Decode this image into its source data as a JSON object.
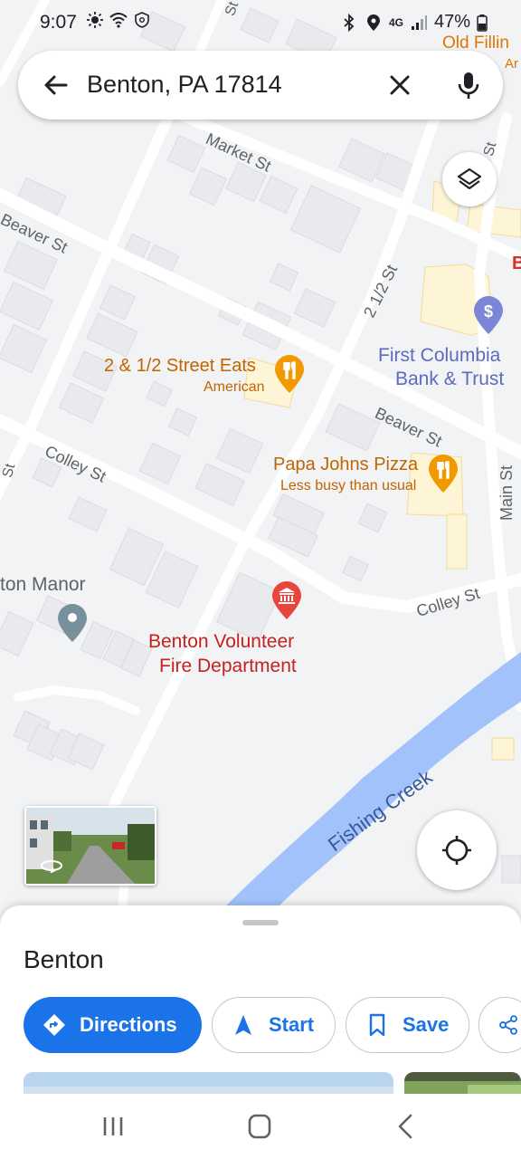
{
  "status_bar": {
    "time": "9:07",
    "left_icons": [
      "sun-icon",
      "wifi-icon",
      "shield-icon"
    ],
    "right_icons": [
      "bluetooth-icon",
      "location-pin-icon",
      "lte-icon",
      "signal-icon",
      "battery-icon"
    ],
    "network": "4G",
    "battery": "47%"
  },
  "search": {
    "query": "Benton, PA 17814",
    "back_icon": "arrow-back-icon",
    "clear_icon": "close-icon",
    "voice_icon": "microphone-icon"
  },
  "map": {
    "streets": [
      "Market St",
      "Beaver St",
      "2 1/2 St",
      "Beaver St",
      "Colley St",
      "Colley St",
      "Main St",
      "St",
      "St",
      "St"
    ],
    "water": "Fishing Creek",
    "pois": [
      {
        "name": "2 & 1/2 Street Eats",
        "sub": "American",
        "icon": "restaurant-icon",
        "color": "#f29900"
      },
      {
        "name": "Papa Johns Pizza",
        "sub": "Less busy than usual",
        "icon": "restaurant-icon",
        "color": "#f29900"
      },
      {
        "name": "First Columbia",
        "name2": "Bank & Trust",
        "icon": "dollar-icon",
        "color": "#7b86d6"
      },
      {
        "name": "Benton Volunteer",
        "name2": "Fire Department",
        "icon": "government-building-icon",
        "color": "#e8453c"
      },
      {
        "name": "ton Manor",
        "icon": "place-pin-icon",
        "color": "#78909c"
      },
      {
        "name": "Old Fillin",
        "sub": "Ar",
        "color": "#e37400"
      },
      {
        "name": "B",
        "color": "#d93025"
      }
    ],
    "colors": {
      "background": "#f1f3f4",
      "road": "#ffffff",
      "water": "#a1c2fa",
      "building": "#e8eaed",
      "commercial": "#fdf5d6"
    }
  },
  "controls": {
    "layers_icon": "layers-icon",
    "my_location_icon": "my-location-icon",
    "street_view_icon": "street-view-rotate-icon"
  },
  "sheet": {
    "title": "Benton",
    "actions": [
      {
        "label": "Directions",
        "icon": "directions-icon"
      },
      {
        "label": "Start",
        "icon": "navigation-arrow-icon"
      },
      {
        "label": "Save",
        "icon": "bookmark-icon"
      },
      {
        "label": "",
        "icon": "share-icon"
      }
    ]
  },
  "nav_bar": {
    "recents_icon": "recent-apps-icon",
    "home_icon": "home-icon",
    "back_icon": "back-chevron-icon"
  },
  "accent": "#1a73e8"
}
